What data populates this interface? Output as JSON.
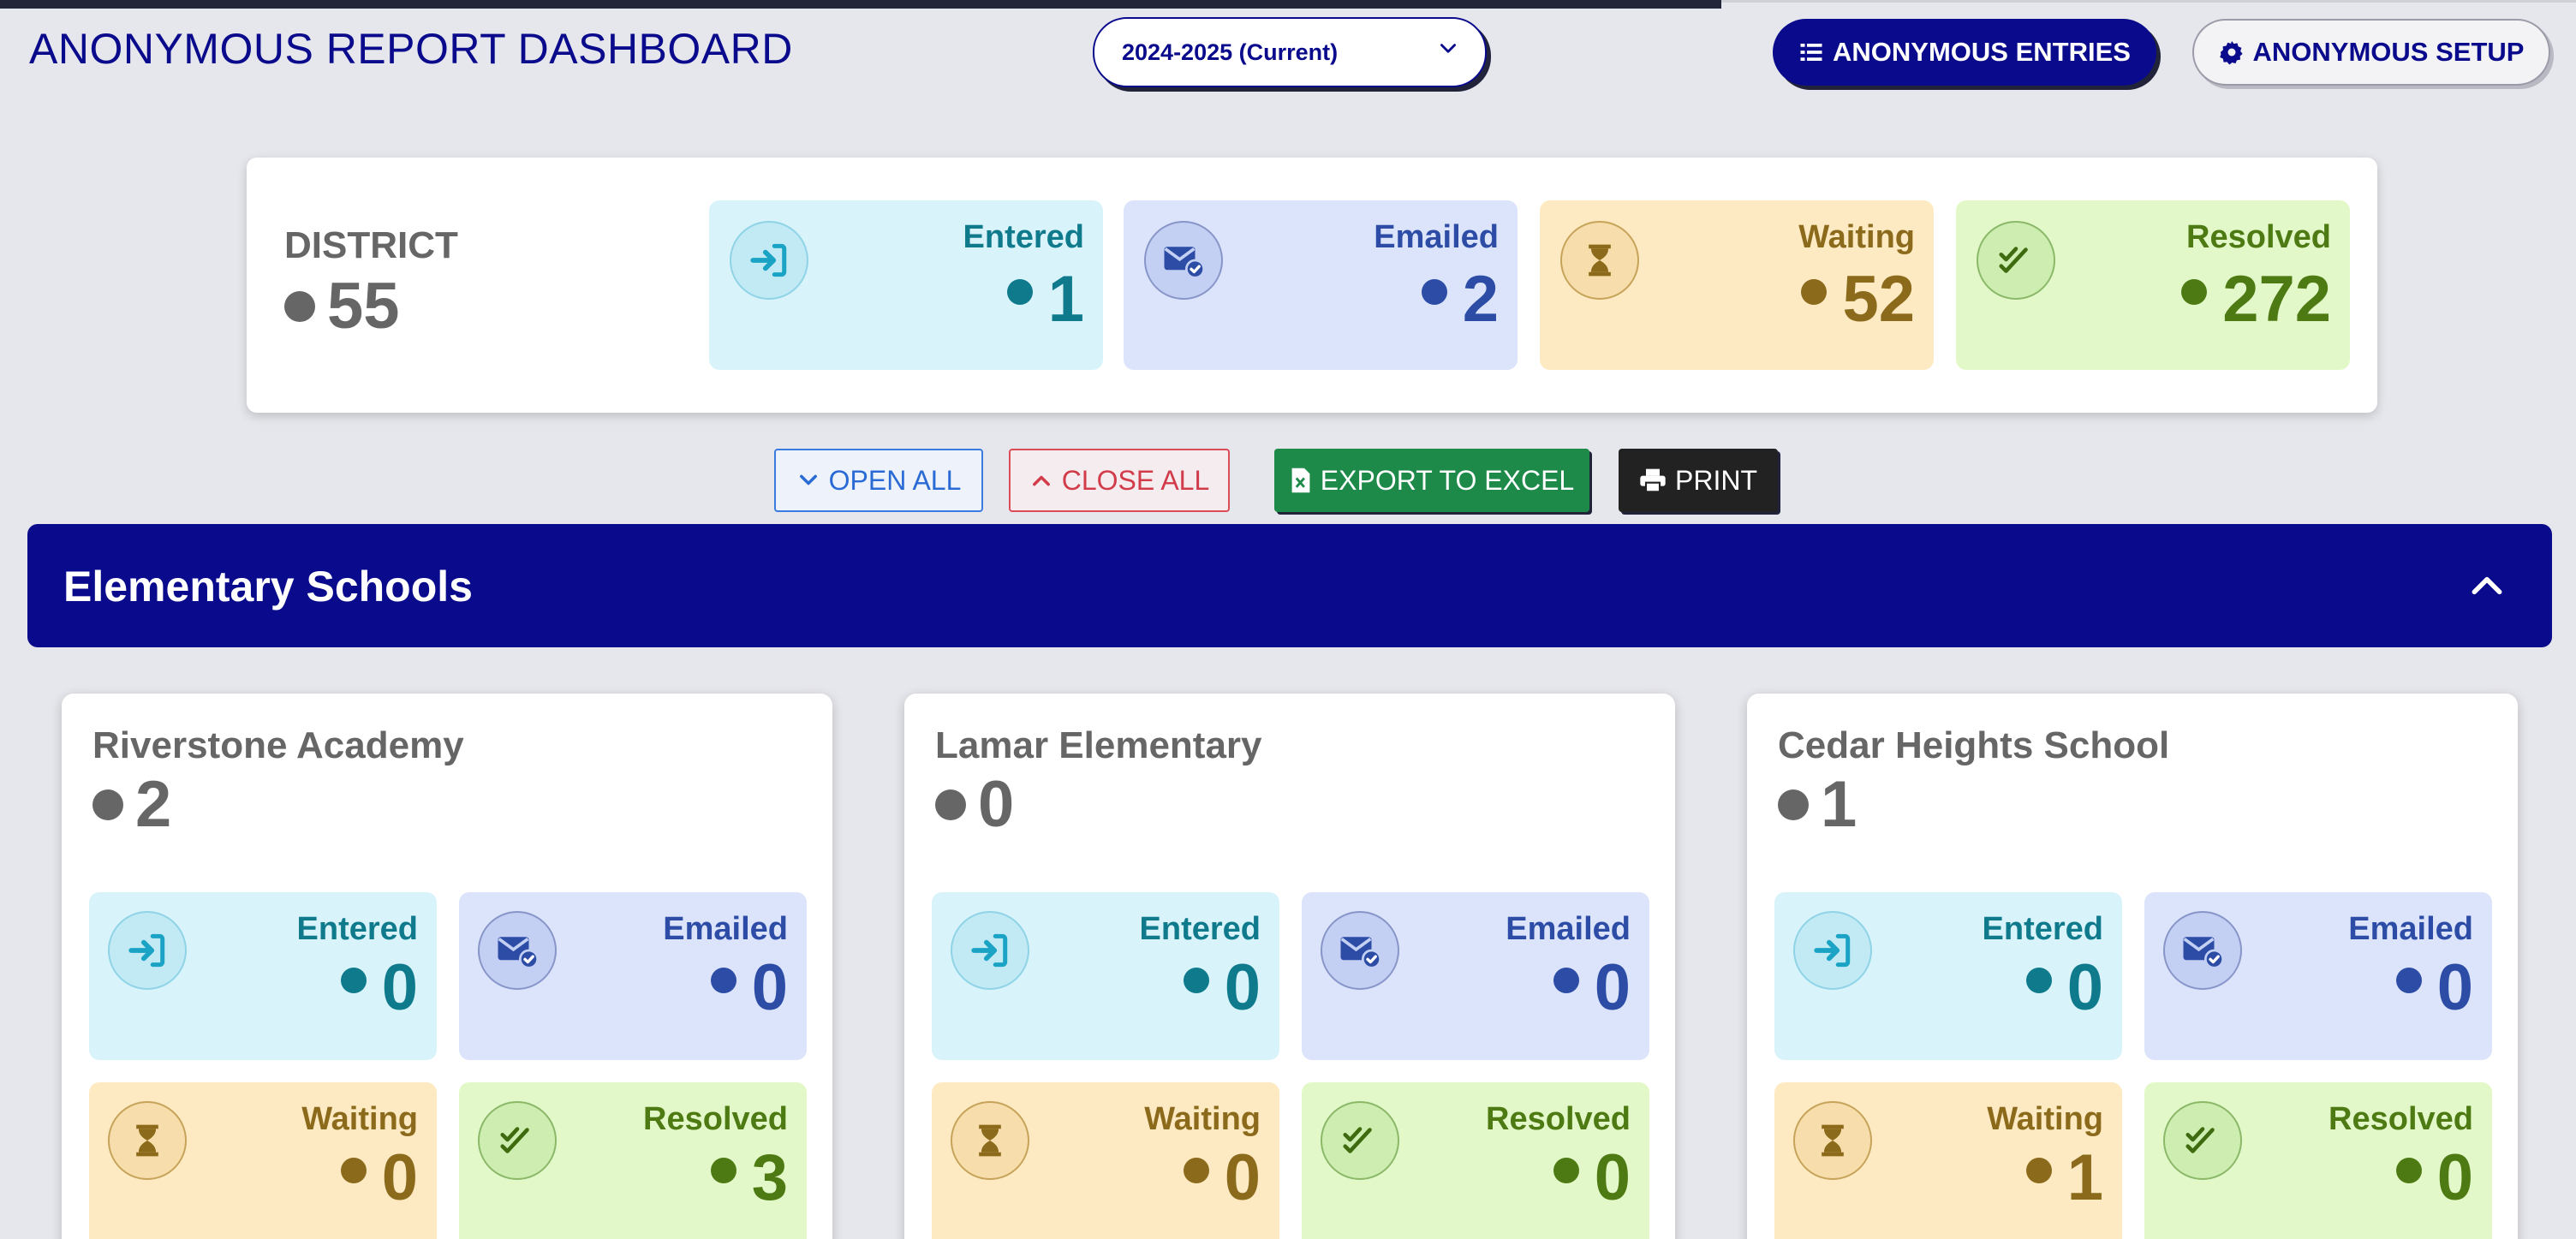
{
  "header": {
    "title": "ANONYMOUS REPORT DASHBOARD",
    "year_select": "2024-2025 (Current)",
    "entries_button": "ANONYMOUS ENTRIES",
    "setup_button": "ANONYMOUS SETUP"
  },
  "district": {
    "label": "DISTRICT",
    "count": "55",
    "tiles": {
      "entered": {
        "label": "Entered",
        "value": "1"
      },
      "emailed": {
        "label": "Emailed",
        "value": "2"
      },
      "waiting": {
        "label": "Waiting",
        "value": "52"
      },
      "resolved": {
        "label": "Resolved",
        "value": "272"
      }
    }
  },
  "actions": {
    "open_all": "OPEN ALL",
    "close_all": "CLOSE ALL",
    "export": "EXPORT TO EXCEL",
    "print": "PRINT"
  },
  "section": {
    "title": "Elementary Schools"
  },
  "schools": [
    {
      "name": "Riverstone Academy",
      "count": "2",
      "entered": {
        "label": "Entered",
        "value": "0"
      },
      "emailed": {
        "label": "Emailed",
        "value": "0"
      },
      "waiting": {
        "label": "Waiting",
        "value": "0"
      },
      "resolved": {
        "label": "Resolved",
        "value": "3"
      }
    },
    {
      "name": "Lamar Elementary",
      "count": "0",
      "entered": {
        "label": "Entered",
        "value": "0"
      },
      "emailed": {
        "label": "Emailed",
        "value": "0"
      },
      "waiting": {
        "label": "Waiting",
        "value": "0"
      },
      "resolved": {
        "label": "Resolved",
        "value": "0"
      }
    },
    {
      "name": "Cedar Heights School",
      "count": "1",
      "entered": {
        "label": "Entered",
        "value": "0"
      },
      "emailed": {
        "label": "Emailed",
        "value": "0"
      },
      "waiting": {
        "label": "Waiting",
        "value": "1"
      },
      "resolved": {
        "label": "Resolved",
        "value": "0"
      }
    }
  ],
  "icons": {
    "entered": "sign-in-icon",
    "emailed": "envelope-check-icon",
    "waiting": "hourglass-icon",
    "resolved": "double-check-icon"
  },
  "colors": {
    "brand": "#0a0a8c",
    "entered": "#0e7a8c",
    "emailed": "#2c4ca6",
    "waiting": "#8c6a1c",
    "resolved": "#4e7a14",
    "export": "#1d8a4a"
  }
}
